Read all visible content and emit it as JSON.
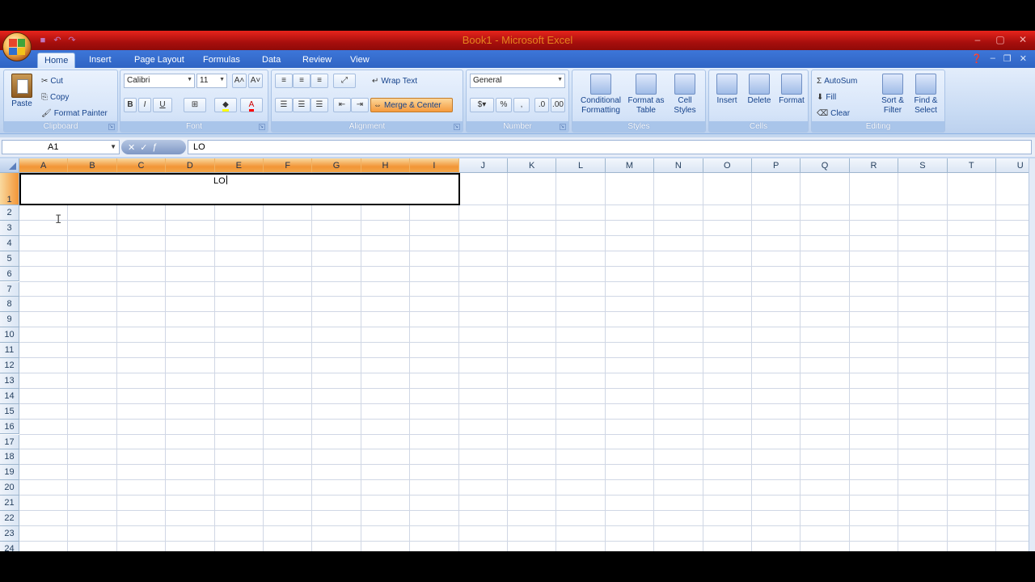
{
  "window": {
    "title": "Book1 - Microsoft Excel",
    "controls": [
      "–",
      "▢",
      "✕"
    ]
  },
  "qat": {
    "items": [
      "save-icon",
      "undo-icon",
      "redo-icon"
    ]
  },
  "tabs": [
    {
      "label": "Home",
      "active": true
    },
    {
      "label": "Insert",
      "active": false
    },
    {
      "label": "Page Layout",
      "active": false
    },
    {
      "label": "Formulas",
      "active": false
    },
    {
      "label": "Data",
      "active": false
    },
    {
      "label": "Review",
      "active": false
    },
    {
      "label": "View",
      "active": false
    }
  ],
  "ribbon": {
    "clipboard": {
      "label": "Clipboard",
      "paste": "Paste",
      "cut": "Cut",
      "copy": "Copy",
      "format_painter": "Format Painter"
    },
    "font": {
      "label": "Font",
      "name": "Calibri",
      "size": "11",
      "bold": "B",
      "italic": "I",
      "underline": "U"
    },
    "alignment": {
      "label": "Alignment",
      "wrap_text": "Wrap Text",
      "merge_center": "Merge & Center"
    },
    "number": {
      "label": "Number",
      "format": "General",
      "percent": "%",
      "comma": ","
    },
    "styles": {
      "label": "Styles",
      "conditional": "Conditional Formatting",
      "format_table": "Format as Table",
      "cell_styles": "Cell Styles"
    },
    "cells": {
      "label": "Cells",
      "insert": "Insert",
      "delete": "Delete",
      "format": "Format"
    },
    "editing": {
      "label": "Editing",
      "autosum": "AutoSum",
      "fill": "Fill",
      "clear": "Clear",
      "sort_filter": "Sort & Filter",
      "find_select": "Find & Select"
    }
  },
  "formula_bar": {
    "name_box": "A1",
    "value": "LO"
  },
  "sheet": {
    "columns": [
      "A",
      "B",
      "C",
      "D",
      "E",
      "F",
      "G",
      "H",
      "I",
      "J",
      "K",
      "L",
      "M",
      "N",
      "O",
      "P",
      "Q",
      "R",
      "S",
      "T",
      "U"
    ],
    "rows": [
      "1",
      "2",
      "3",
      "4",
      "5",
      "6",
      "7",
      "8",
      "9",
      "10",
      "11",
      "12",
      "13",
      "14",
      "15",
      "16",
      "17",
      "18",
      "19",
      "20",
      "21",
      "22",
      "23",
      "24"
    ],
    "selected_columns": [
      "A",
      "B",
      "C",
      "D",
      "E",
      "F",
      "G",
      "H",
      "I"
    ],
    "merged_cell_text": "LO"
  },
  "colors": {
    "title_bar": "#b5120f",
    "tab_bar": "#3568cc",
    "selection_header": "#f29536",
    "gridline": "#d0d7e5"
  }
}
